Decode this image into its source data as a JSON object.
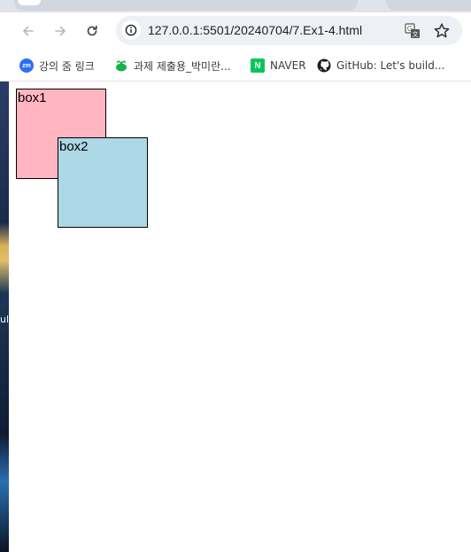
{
  "browser": {
    "url": "127.0.0.1:5501/20240704/7.Ex1-4.html",
    "nav_icons": [
      "back-arrow-icon",
      "forward-arrow-icon",
      "reload-icon"
    ],
    "omnibox_icons": [
      "site-info-icon",
      "translate-icon",
      "bookmark-star-icon"
    ]
  },
  "bookmarks": [
    {
      "label": "강의 줌 링크",
      "icon": "zoom-icon",
      "icon_text": "zm"
    },
    {
      "label": "과제 제출용_박미란...",
      "icon": "leaf-icon"
    },
    {
      "label": "NAVER",
      "icon": "naver-icon",
      "icon_text": "N"
    },
    {
      "label": "GitHub: Let's build...",
      "icon": "github-icon"
    }
  ],
  "page": {
    "box1": {
      "label": "box1",
      "color": "#ffb6c1"
    },
    "box2": {
      "label": "box2",
      "color": "#add8e6"
    }
  },
  "desktop": {
    "visible_text": "ul"
  }
}
